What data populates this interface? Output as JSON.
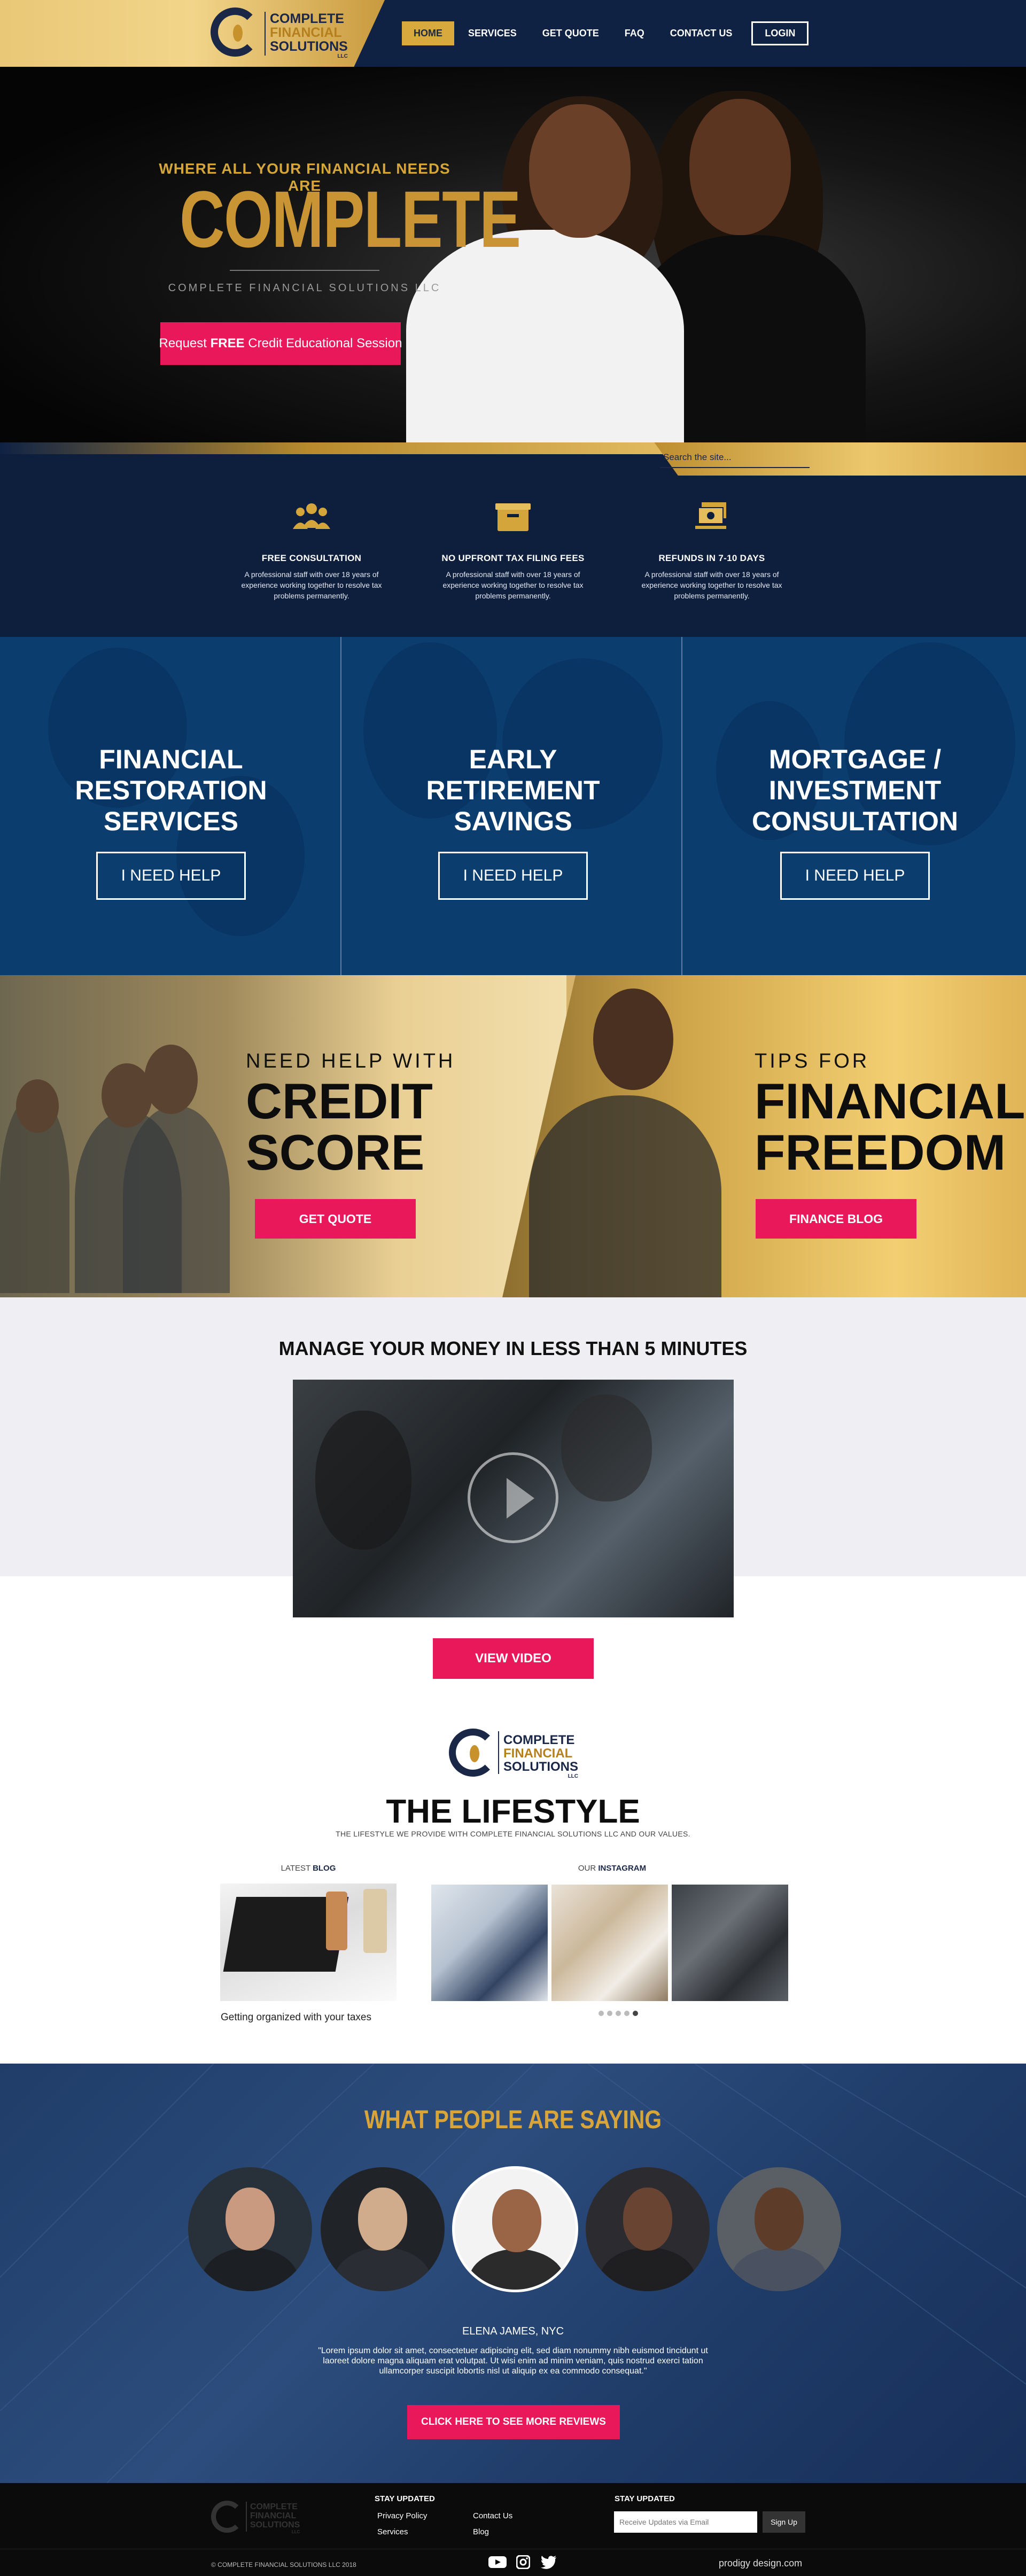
{
  "header": {
    "logo": {
      "line1": "COMPLETE",
      "line2": "FINANCIAL",
      "line3": "SOLUTIONS",
      "suffix": "LLC"
    },
    "nav": {
      "home": "HOME",
      "services": "SERVICES",
      "get_quote": "GET QUOTE",
      "faq": "FAQ",
      "contact": "CONTACT US",
      "login": "LOGIN"
    }
  },
  "hero": {
    "tagline": "WHERE ALL YOUR FINANCIAL NEEDS ARE",
    "title": "COMPLETE",
    "company": "COMPLETE FINANCIAL SOLUTIONS LLC",
    "cta_prefix": "Request ",
    "cta_bold": "FREE",
    "cta_suffix": " Credit Educational Session"
  },
  "search": {
    "placeholder": "Search the site..."
  },
  "features": [
    {
      "title": "FREE CONSULTATION",
      "desc": "A professional staff with over 18 years of experience working together to resolve tax problems permanently.",
      "icon": "people-icon"
    },
    {
      "title": "NO UPFRONT TAX FILING FEES",
      "desc": "A professional staff with over 18 years of experience working together to resolve tax problems permanently.",
      "icon": "box-icon"
    },
    {
      "title": "REFUNDS IN 7-10 DAYS",
      "desc": "A professional staff with over 18 years of experience working together to resolve tax problems permanently.",
      "icon": "money-icon"
    }
  ],
  "services": [
    {
      "line1": "FINANCIAL",
      "line2": "RESTORATION",
      "line3": "SERVICES",
      "button": "I NEED HELP"
    },
    {
      "line1": "EARLY",
      "line2": "RETIREMENT",
      "line3": "SAVINGS",
      "button": "I NEED HELP"
    },
    {
      "line1": "MORTGAGE /",
      "line2": "INVESTMENT",
      "line3": "CONSULTATION",
      "button": "I NEED HELP"
    }
  ],
  "promo": {
    "left": {
      "kicker": "NEED HELP WITH",
      "line1": "CREDIT",
      "line2": "SCORE",
      "button": "GET QUOTE"
    },
    "right": {
      "kicker": "TIPS FOR",
      "line1": "FINANCIAL",
      "line2": "FREEDOM",
      "button": "FINANCE BLOG"
    }
  },
  "video": {
    "title": "MANAGE YOUR MONEY IN LESS THAN 5 MINUTES",
    "button": "VIEW VIDEO"
  },
  "lifestyle": {
    "logo": {
      "line1": "COMPLETE",
      "line2": "FINANCIAL",
      "line3": "SOLUTIONS",
      "suffix": "LLC"
    },
    "title": "THE LIFESTYLE",
    "subtitle": "THE LIFESTYLE WE PROVIDE WITH COMPLETE FINANCIAL SOLUTIONS LLC AND OUR VALUES.",
    "blog_label_prefix": "LATEST ",
    "blog_label_bold": "BLOG",
    "blog_caption": "Getting organized with your taxes",
    "insta_label_prefix": "OUR ",
    "insta_label_bold": "INSTAGRAM",
    "carousel_active": 5,
    "carousel_total": 5
  },
  "testimonials": {
    "title": "WHAT PEOPLE ARE SAYING",
    "name": "ELENA JAMES, NYC",
    "quote": "\"Lorem ipsum dolor sit amet, consectetuer adipiscing elit, sed diam nonummy nibh euismod tincidunt ut laoreet dolore magna aliquam erat volutpat. Ut wisi enim ad minim veniam, quis nostrud exerci tation ullamcorper suscipit lobortis nisl ut aliquip ex ea commodo consequat.\"",
    "button": "CLICK HERE TO SEE MORE REVIEWS"
  },
  "footer": {
    "logo": {
      "line1": "COMPLETE",
      "line2": "FINANCIAL",
      "line3": "SOLUTIONS",
      "suffix": "LLC"
    },
    "stay_updated_1": "STAY UPDATED",
    "links": {
      "privacy": "Privacy Policy",
      "services": "Services",
      "contact": "Contact Us",
      "blog": "Blog"
    },
    "stay_updated_2": "STAY UPDATED",
    "email_placeholder": "Receive Updates via Email",
    "signup": "Sign Up",
    "copyright": "© COMPLETE FINANCIAL SOLUTIONS LLC 2018",
    "credit": "prodigy design.com",
    "social": [
      "youtube-icon",
      "instagram-icon",
      "twitter-icon"
    ]
  },
  "colors": {
    "navy": "#0f2244",
    "gold": "#d8aa3d",
    "pink": "#e8185a",
    "service_blue": "#0b3d6f"
  }
}
